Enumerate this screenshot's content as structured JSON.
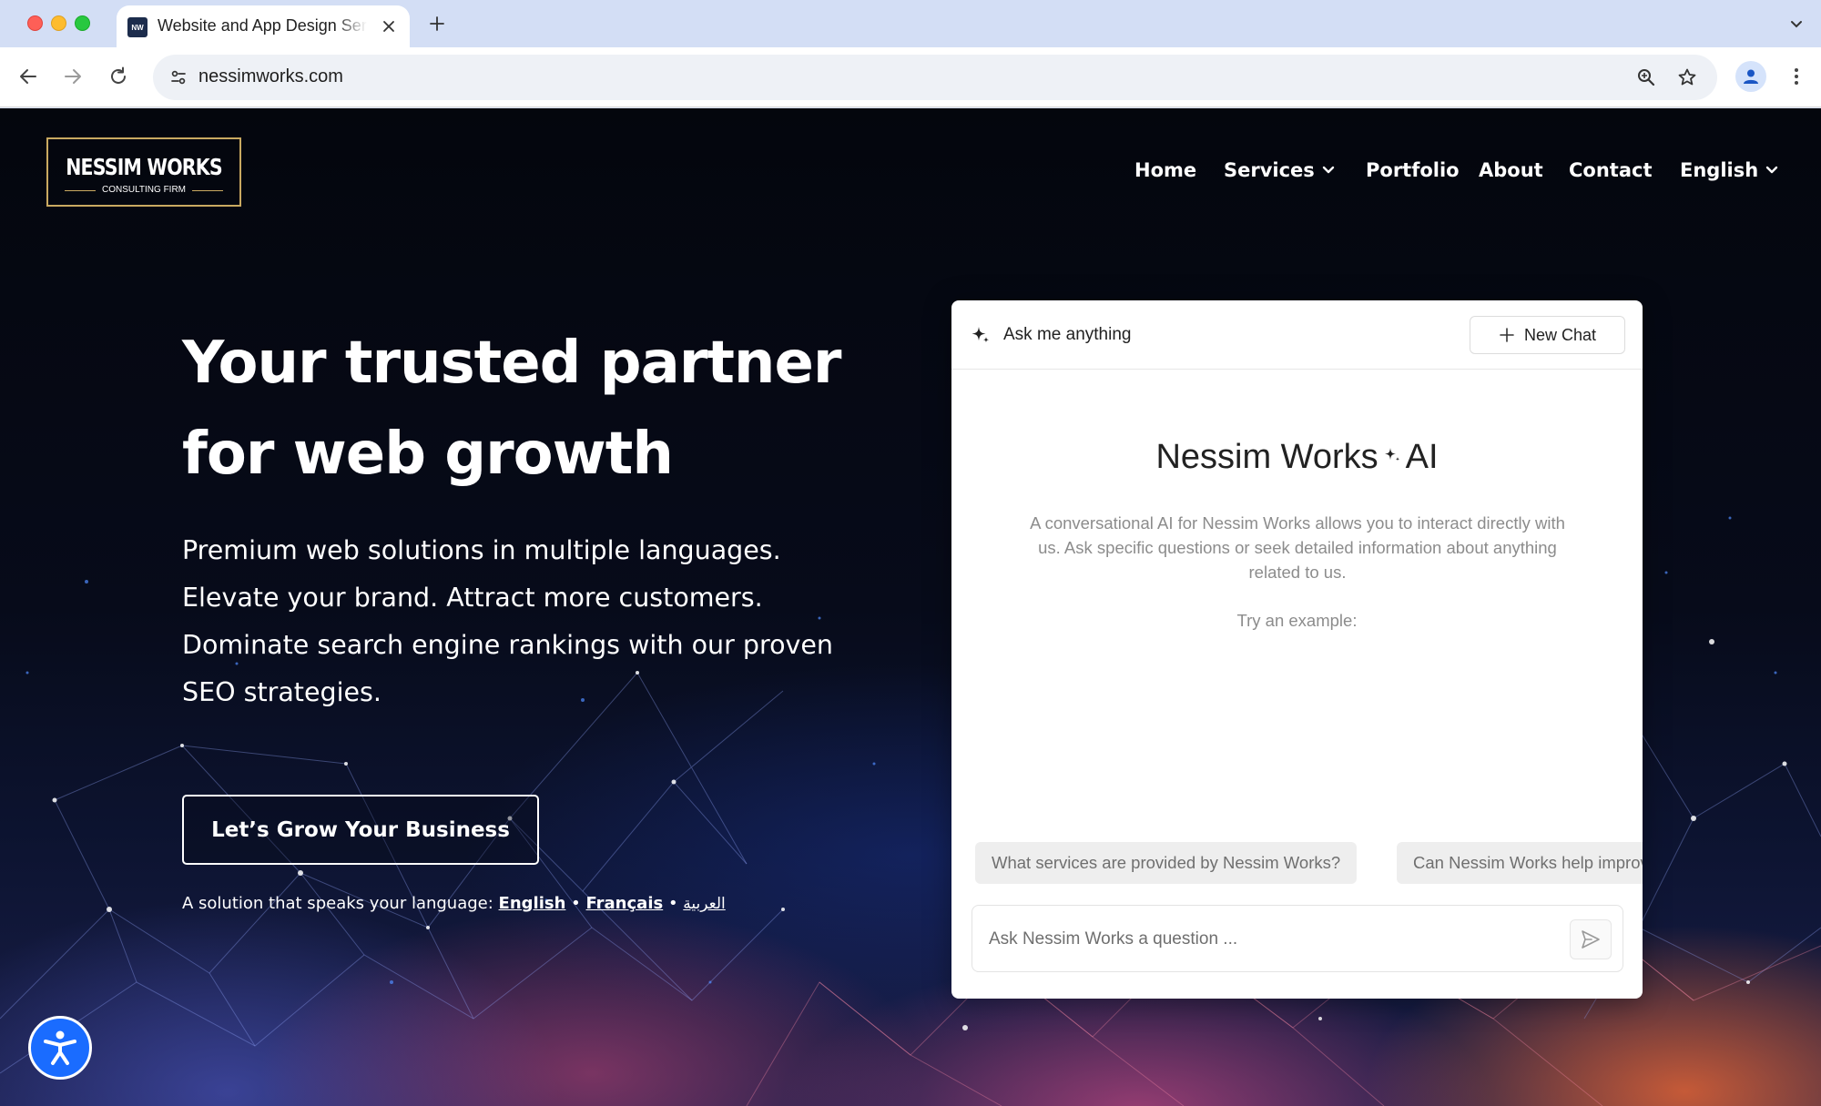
{
  "browser": {
    "tab_title": "Website and App Design Services",
    "url": "nessimworks.com",
    "favicon_text": "NW"
  },
  "site": {
    "logo_main": "NESSIM WORKS",
    "logo_sub": "CONSULTING FIRM",
    "nav": {
      "home": "Home",
      "services": "Services",
      "portfolio": "Portfolio",
      "about": "About",
      "contact": "Contact",
      "language": "English"
    },
    "hero": {
      "title_line1": "Your trusted partner",
      "title_line2": "for web growth",
      "subtitle_lines": [
        "Premium web solutions in multiple languages.",
        "Elevate your brand. Attract more customers.",
        "Dominate search engine rankings with our proven",
        "SEO strategies."
      ],
      "cta": "Let’s Grow Your Business",
      "lang_prefix": "A solution that speaks your language:",
      "lang_english": "English",
      "lang_french": "Français",
      "lang_arabic": "العربية",
      "separator": "•"
    }
  },
  "chat": {
    "header_title": "Ask me anything",
    "new_chat": "New Chat",
    "title_main": "Nessim Works",
    "title_ai": "AI",
    "description": "A conversational AI for Nessim Works allows you to interact directly with us. Ask specific questions or seek detailed information about anything related to us.",
    "try_label": "Try an example:",
    "examples": [
      "What services are provided by Nessim Works?",
      "Can Nessim Works help improve my website?"
    ],
    "input_placeholder": "Ask Nessim Works a question ..."
  },
  "colors": {
    "logo_gold": "#c9a961",
    "accessibility_blue": "#1a6cff",
    "page_dark": "#04060d"
  }
}
